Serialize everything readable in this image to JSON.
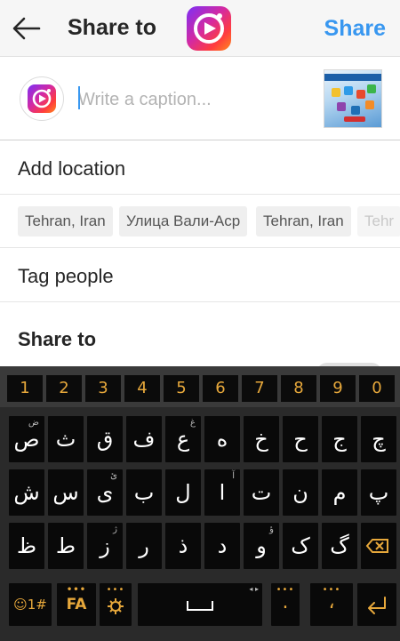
{
  "header": {
    "title": "Share to",
    "share_label": "Share",
    "back_icon": "back-arrow-icon"
  },
  "caption": {
    "placeholder": "Write a caption..."
  },
  "add_location_label": "Add location",
  "location_suggestions": [
    "Tehran, Iran",
    "Улица Вали-Аср",
    "Tehran, Iran",
    "Tehr"
  ],
  "tag_people_label": "Tag people",
  "share_to_label": "Share to",
  "keyboard": {
    "numbers": [
      "1",
      "2",
      "3",
      "4",
      "5",
      "6",
      "7",
      "8",
      "9",
      "0"
    ],
    "row1": [
      {
        "char": "چ",
        "sub": ""
      },
      {
        "char": "ج",
        "sub": ""
      },
      {
        "char": "ح",
        "sub": ""
      },
      {
        "char": "خ",
        "sub": ""
      },
      {
        "char": "ه",
        "sub": ""
      },
      {
        "char": "ع",
        "sub": "غ"
      },
      {
        "char": "ف",
        "sub": ""
      },
      {
        "char": "ق",
        "sub": ""
      },
      {
        "char": "ث",
        "sub": ""
      },
      {
        "char": "ص",
        "sub": "ض"
      }
    ],
    "row2": [
      {
        "char": "پ",
        "sub": ""
      },
      {
        "char": "م",
        "sub": ""
      },
      {
        "char": "ن",
        "sub": ""
      },
      {
        "char": "ت",
        "sub": ""
      },
      {
        "char": "ا",
        "sub": "آ"
      },
      {
        "char": "ل",
        "sub": ""
      },
      {
        "char": "ب",
        "sub": ""
      },
      {
        "char": "ی",
        "sub": "ئ"
      },
      {
        "char": "س",
        "sub": ""
      },
      {
        "char": "ش",
        "sub": ""
      }
    ],
    "row3": [
      {
        "char": "گ",
        "sub": ""
      },
      {
        "char": "ک",
        "sub": ""
      },
      {
        "char": "و",
        "sub": "ؤ"
      },
      {
        "char": "د",
        "sub": ""
      },
      {
        "char": "ذ",
        "sub": ""
      },
      {
        "char": "ر",
        "sub": ""
      },
      {
        "char": "ز",
        "sub": "ژ"
      },
      {
        "char": "ط",
        "sub": ""
      },
      {
        "char": "ظ",
        "sub": ""
      }
    ],
    "emoji_key": "☺1#",
    "lang_key": "FA",
    "settings_icon": "gear-icon",
    "space_icon": "space-bar-icon",
    "period_key": ".",
    "comma_key": "،",
    "enter_icon": "enter-icon",
    "backspace_icon": "backspace-icon",
    "accent_color": "#e7a83b"
  }
}
